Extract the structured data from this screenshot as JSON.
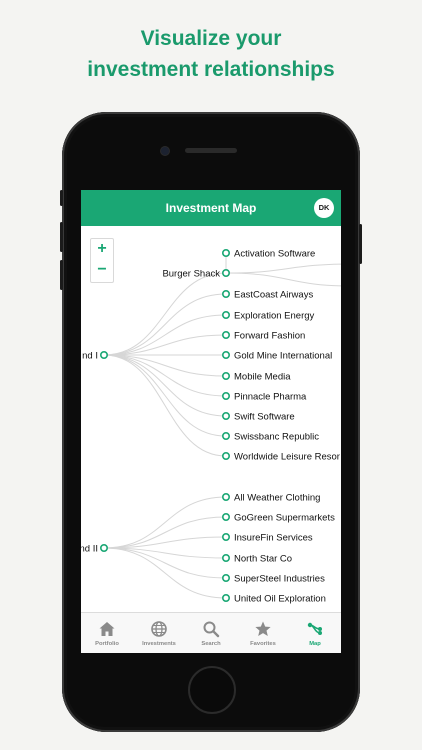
{
  "headline": {
    "line1": "Visualize your",
    "line2": "investment relationships"
  },
  "app": {
    "title": "Investment Map",
    "avatar_initials": "DK",
    "accent_color": "#1aa774"
  },
  "zoom": {
    "in_label": "+",
    "out_label": "−"
  },
  "tree": {
    "fund1": {
      "label": "nd I",
      "children": [
        {
          "label": "Burger Shack",
          "expandable": true
        },
        {
          "label": "EastCoast Airways"
        },
        {
          "label": "Exploration Energy"
        },
        {
          "label": "Forward Fashion"
        },
        {
          "label": "Gold Mine International"
        },
        {
          "label": "Mobile Media"
        },
        {
          "label": "Pinnacle Pharma"
        },
        {
          "label": "Swift Software"
        },
        {
          "label": "Swissbanc Republic"
        },
        {
          "label": "Worldwide Leisure Resor"
        }
      ],
      "burger_shack_children": [
        {
          "label": "Activation Software"
        }
      ]
    },
    "fund2": {
      "label": "nd II",
      "children": [
        {
          "label": "All Weather Clothing"
        },
        {
          "label": "GoGreen Supermarkets"
        },
        {
          "label": "InsureFin Services"
        },
        {
          "label": "North Star Co"
        },
        {
          "label": "SuperSteel Industries"
        },
        {
          "label": "United Oil Exploration"
        }
      ]
    }
  },
  "tabs": [
    {
      "label": "Portfolio",
      "icon": "home-icon",
      "active": false
    },
    {
      "label": "Investments",
      "icon": "globe-icon",
      "active": false
    },
    {
      "label": "Search",
      "icon": "search-icon",
      "active": false
    },
    {
      "label": "Favorites",
      "icon": "star-icon",
      "active": false
    },
    {
      "label": "Map",
      "icon": "map-network-icon",
      "active": true
    }
  ]
}
